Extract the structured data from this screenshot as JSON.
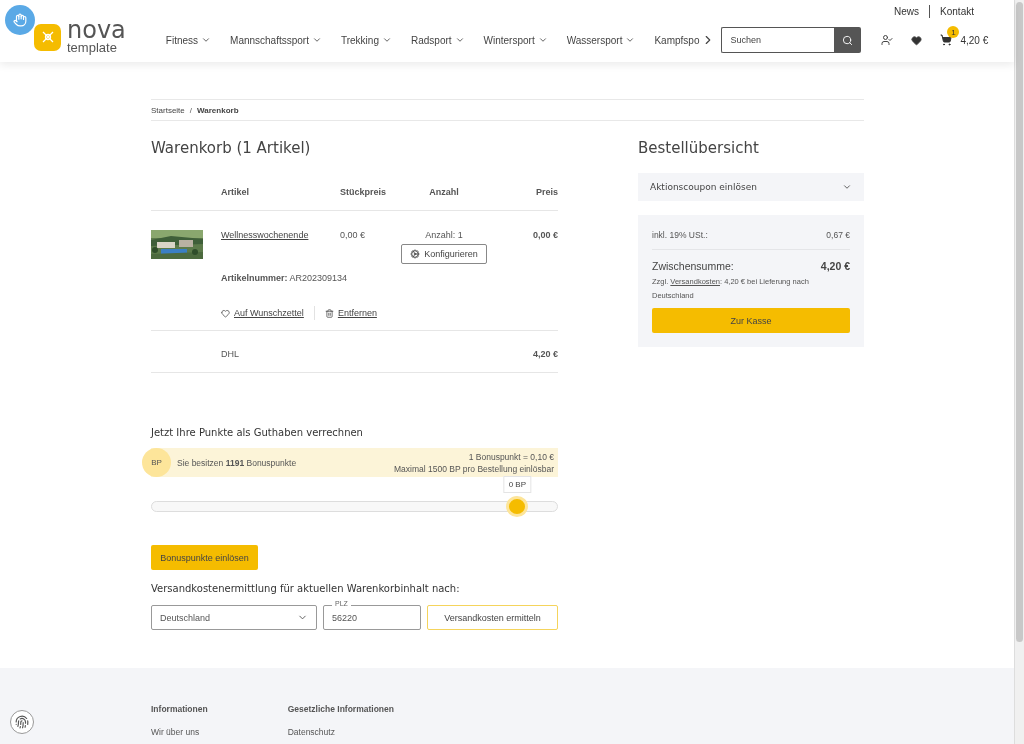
{
  "header": {
    "top_links": [
      "News",
      "Kontakt"
    ],
    "logo": {
      "name": "nova",
      "sub": "template"
    },
    "nav": [
      "Fitness",
      "Mannschaftssport",
      "Trekking",
      "Radsport",
      "Wintersport",
      "Wassersport",
      "Kampfspo"
    ],
    "search": {
      "placeholder": "Suchen"
    },
    "cart": {
      "count": "1",
      "total": "4,20 €"
    }
  },
  "breadcrumb": {
    "separator": "/",
    "items": [
      {
        "label": "Startseite",
        "selected": false
      },
      {
        "label": "Warenkorb",
        "selected": true
      }
    ]
  },
  "cart": {
    "title": "Warenkorb (1 Artikel)",
    "columns": [
      "Artikel",
      "Stückpreis",
      "Anzahl",
      "Preis"
    ],
    "items": [
      {
        "name": "Wellnesswochenende",
        "unit_price": "0,00 €",
        "quantity": "Anzahl: 1",
        "configure": "Konfigurieren",
        "sku_label": "Artikelnummer:",
        "sku": "AR202309134",
        "price": "0,00 €",
        "wishlist": "Auf Wunschzettel",
        "remove": "Entfernen"
      }
    ],
    "shipping": {
      "label": "DHL",
      "price": "4,20 €"
    }
  },
  "bonus": {
    "title": "Jetzt Ihre Punkte als Guthaben verrechnen",
    "badge": "BP",
    "owned": "Sie besitzen **1191** Bonuspunkte",
    "rate": "1 Bonuspunkt = 0,10 €",
    "max": "Maximal 1500 BP pro Bestellung einlösbar",
    "slider": {
      "level": 0.9,
      "tooltip": "0 BP"
    },
    "button": "Bonuspunkte einlösen"
  },
  "shipping_calc": {
    "title": "Versandkostenermittlung für aktuellen Warenkorbinhalt nach:",
    "country": "Deutschland",
    "zip": {
      "label": "PLZ",
      "value": "56220"
    },
    "button": "Versandkosten ermitteln"
  },
  "summary": {
    "title": "Bestellübersicht",
    "coupon": {
      "label": "Aktionscoupon einlösen",
      "expanded": false
    },
    "tax": {
      "label": "inkl. 19% USt.:",
      "value": "0,67 €"
    },
    "subtotal": {
      "label": "Zwischensumme:",
      "value": "4,20 €"
    },
    "shipping_note": {
      "prefix": "Zzgl.",
      "link": "Versandkosten",
      "suffix": ": 4,20 € bei Lieferung nach Deutschland"
    },
    "checkout": "Zur Kasse"
  },
  "footer": {
    "columns": [
      {
        "title": "Informationen",
        "links": [
          "Wir über uns"
        ]
      },
      {
        "title": "Gesetzliche Informationen",
        "links": [
          "Datenschutz"
        ]
      }
    ]
  }
}
